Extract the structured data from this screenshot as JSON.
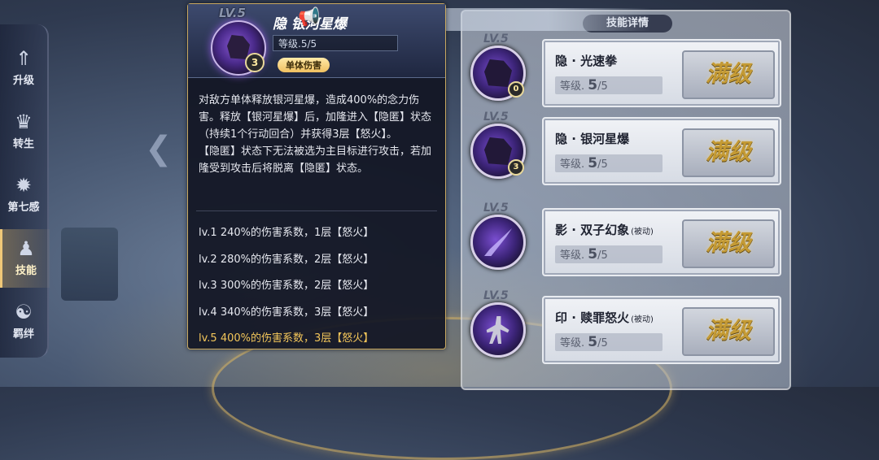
{
  "side_nav": [
    {
      "label": "升级",
      "icon": "upgrade-icon",
      "active": false
    },
    {
      "label": "转生",
      "icon": "rebirth-icon",
      "active": false
    },
    {
      "label": "第七感",
      "icon": "seventh-sense-icon",
      "active": false
    },
    {
      "label": "技能",
      "icon": "skill-icon",
      "active": true
    },
    {
      "label": "羁绊",
      "icon": "bond-icon",
      "active": false
    }
  ],
  "detail": {
    "lv": "LV.5",
    "name": "隐·银河星爆",
    "name_display": "隐  银河星爆",
    "level_text": "等级.5/5",
    "badge": "3",
    "tag": "单体伤害",
    "description": [
      "对敌方单体释放银河星爆，造成400%的念力伤害。释放【银河星爆】后，加隆进入【隐匿】状态（持续1个行动回合）并获得3层【怒火】。",
      "【隐匿】状态下无法被选为主目标进行攻击，若加隆受到攻击后将脱离【隐匿】状态。"
    ],
    "levels": [
      "lv.1 240%的伤害系数，1层【怒火】",
      "lv.2 280%的伤害系数，2层【怒火】",
      "lv.3 300%的伤害系数，2层【怒火】",
      "lv.4 340%的伤害系数，3层【怒火】",
      "lv.5 400%的伤害系数，3层【怒火】"
    ]
  },
  "list": {
    "title": "技能详情",
    "items": [
      {
        "lv": "LV.5",
        "name": "隐 · 光速拳",
        "passive": "",
        "level_label": "等级.",
        "level_value": "5",
        "level_max": "/5",
        "badge": "0",
        "max_label": "满级"
      },
      {
        "lv": "LV.5",
        "name": "隐 · 银河星爆",
        "passive": "",
        "level_label": "等级.",
        "level_value": "5",
        "level_max": "/5",
        "badge": "3",
        "max_label": "满级"
      },
      {
        "lv": "LV.5",
        "name": "影 · 双子幻象",
        "passive": "(被动)",
        "level_label": "等级.",
        "level_value": "5",
        "level_max": "/5",
        "badge": "",
        "max_label": "满级"
      },
      {
        "lv": "LV.5",
        "name": "印 · 赎罪怒火",
        "passive": "(被动)",
        "level_label": "等级.",
        "level_value": "5",
        "level_max": "/5",
        "badge": "",
        "max_label": "满级"
      }
    ]
  }
}
